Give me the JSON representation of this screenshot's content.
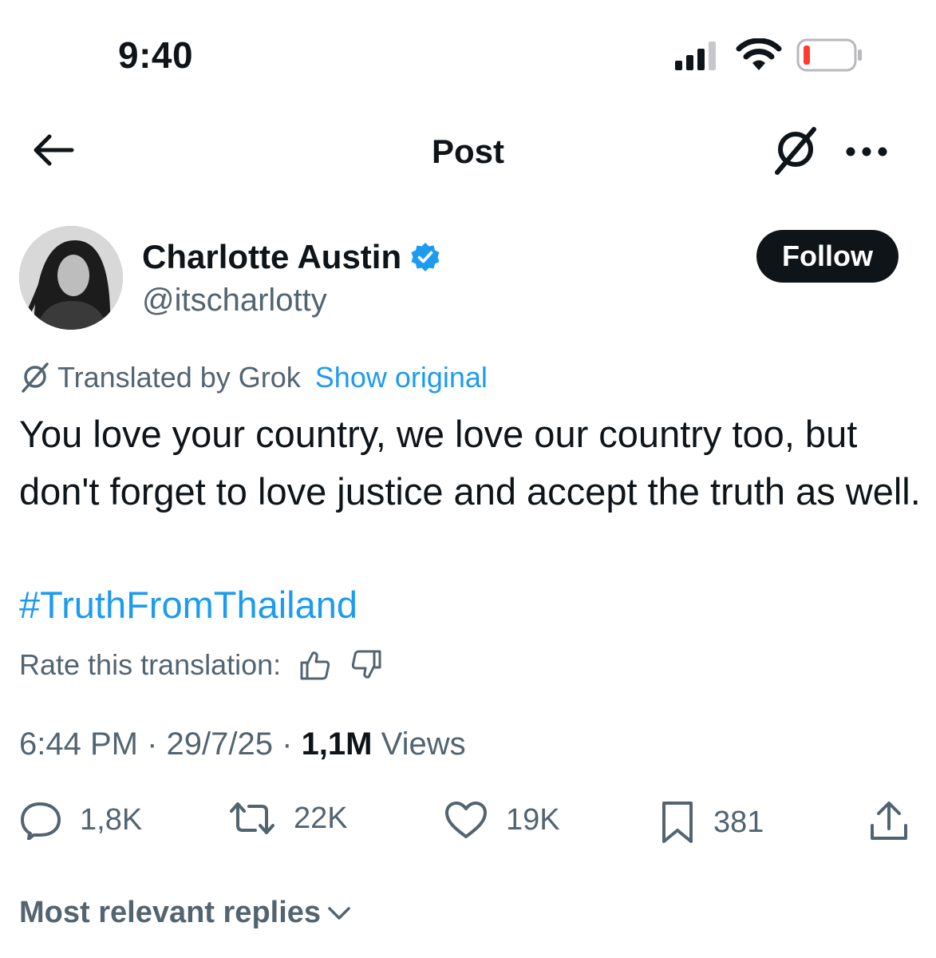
{
  "status_bar": {
    "time": "9:40",
    "signal_icon": "cellular-signal-icon",
    "wifi_icon": "wifi-icon",
    "battery_icon": "battery-low-icon",
    "battery_color": "#ff3b30"
  },
  "nav": {
    "back_icon": "arrow-left-icon",
    "title": "Post",
    "grok_icon": "grok-icon",
    "more_icon": "more-dots-icon"
  },
  "author": {
    "display_name": "Charlotte Austin",
    "verified_icon": "verified-badge-icon",
    "handle": "@itscharlotty",
    "follow_label": "Follow"
  },
  "translation": {
    "label": "Translated by Grok",
    "show_original": "Show original",
    "rate_label": "Rate this translation:",
    "thumbs_up_icon": "thumbs-up-icon",
    "thumbs_down_icon": "thumbs-down-icon"
  },
  "post": {
    "text": "You love your country, we love our country too, but don't forget to love justice and accept the truth as well.",
    "hashtag": "#TruthFromThailand"
  },
  "meta": {
    "time": "6:44 PM",
    "date": "29/7/25",
    "views_count": "1,1M",
    "views_label": "Views"
  },
  "actions": {
    "replies": "1,8K",
    "reposts": "22K",
    "likes": "19K",
    "bookmarks": "381"
  },
  "replies_sort": {
    "label": "Most relevant replies",
    "icon": "chevron-down-icon"
  },
  "colors": {
    "accent": "#1d9bf0",
    "text": "#0f1419",
    "secondary": "#536471",
    "follow_bg": "#0f1419"
  }
}
